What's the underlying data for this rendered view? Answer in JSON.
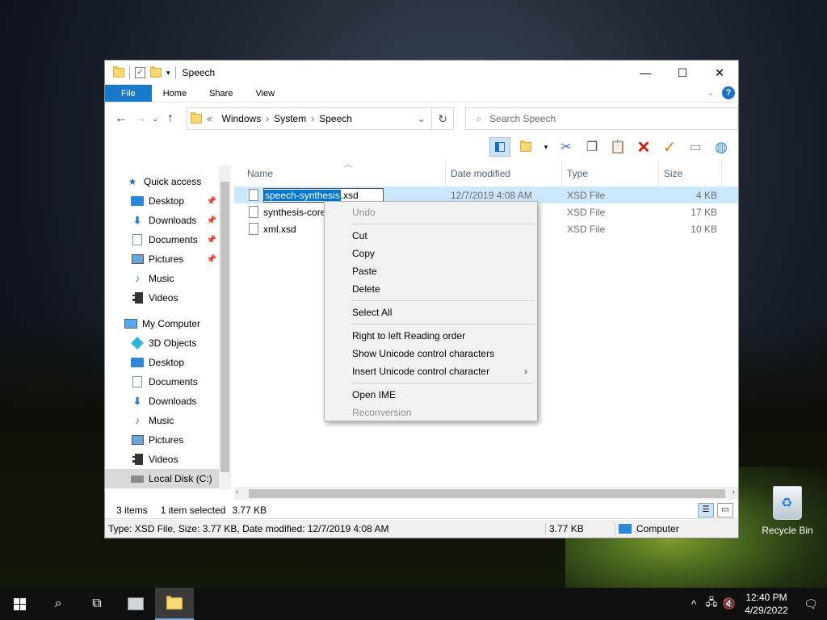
{
  "window": {
    "title": "Speech",
    "controls": {
      "minimize": "—",
      "maximize": "☐",
      "close": "✕"
    }
  },
  "ribbon": {
    "tabs": [
      "File",
      "Home",
      "Share",
      "View"
    ]
  },
  "address": {
    "prefix": "«",
    "crumbs": [
      "Windows",
      "System",
      "Speech"
    ]
  },
  "search": {
    "placeholder": "Search Speech"
  },
  "columns": {
    "name": "Name",
    "date": "Date modified",
    "type": "Type",
    "size": "Size"
  },
  "files": [
    {
      "name": "speech-synthesis.xsd",
      "rename_highlight": "speech-synthesis",
      "rename_rest": ".xsd",
      "date": "12/7/2019 4:08 AM",
      "type": "XSD File",
      "size": "4 KB"
    },
    {
      "name": "synthesis-core",
      "date": "",
      "type": "XSD File",
      "size": "17 KB"
    },
    {
      "name": "xml.xsd",
      "date": "",
      "type": "XSD File",
      "size": "10 KB"
    }
  ],
  "nav": {
    "quick_access": "Quick access",
    "quick_items": [
      "Desktop",
      "Downloads",
      "Documents",
      "Pictures",
      "Music",
      "Videos"
    ],
    "my_computer": "My Computer",
    "computer_items": [
      "3D Objects",
      "Desktop",
      "Documents",
      "Downloads",
      "Music",
      "Pictures",
      "Videos",
      "Local Disk (C:)"
    ]
  },
  "context_menu": {
    "undo": "Undo",
    "cut": "Cut",
    "copy": "Copy",
    "paste": "Paste",
    "delete": "Delete",
    "select_all": "Select All",
    "rtl": "Right to left Reading order",
    "show_unicode": "Show Unicode control characters",
    "insert_unicode": "Insert Unicode control character",
    "open_ime": "Open IME",
    "reconversion": "Reconversion"
  },
  "status": {
    "items": "3 items",
    "selected": "1 item selected",
    "selected_size": "3.77 KB"
  },
  "details": {
    "info": "Type: XSD File, Size: 3.77 KB, Date modified: 12/7/2019 4:08 AM",
    "size": "3.77 KB",
    "location": "Computer"
  },
  "desktop": {
    "recycle_bin": "Recycle Bin"
  },
  "taskbar": {
    "time": "12:40 PM",
    "date": "4/29/2022"
  }
}
